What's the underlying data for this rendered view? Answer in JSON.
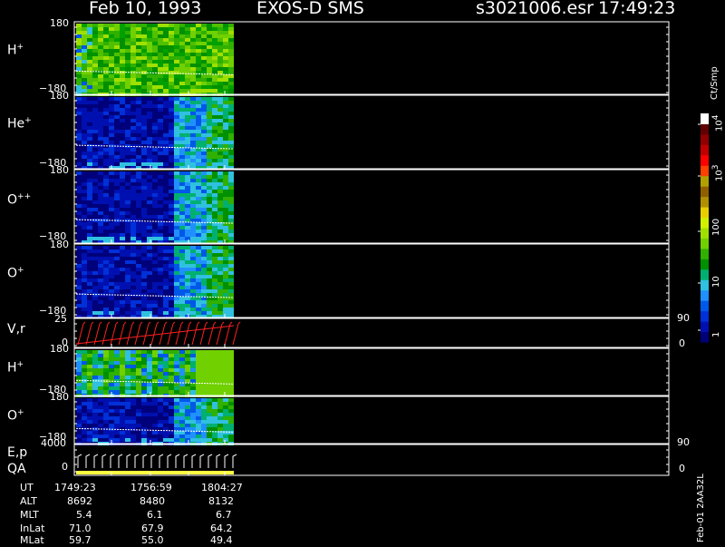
{
  "header": {
    "date": "Feb 10, 1993",
    "instrument": "EXOS-D SMS",
    "file": "s3021006.esr",
    "time": "17:49:23"
  },
  "colorbar": {
    "unit": "Ct/Smp",
    "ticks": [
      "1",
      "10",
      "100",
      "10",
      "10"
    ],
    "tick_exps": [
      "",
      "",
      "",
      "3",
      "4"
    ],
    "colors": [
      "#00007a",
      "#0010b0",
      "#0030d8",
      "#0058e8",
      "#2090ff",
      "#30c0e0",
      "#00b070",
      "#009000",
      "#30b000",
      "#70d000",
      "#a0e000",
      "#d0f000",
      "#e8d000",
      "#b09000",
      "#906000",
      "#b0a000",
      "#ff4000",
      "#ff0000",
      "#c00000",
      "#900000",
      "#600000",
      "#ffffff"
    ]
  },
  "panels": [
    {
      "species": "H",
      "charge": "+",
      "ymax": "180",
      "ymin": "−180"
    },
    {
      "species": "He",
      "charge": "+",
      "ymax": "180",
      "ymin": "−180"
    },
    {
      "species": "O",
      "charge": "++",
      "ymax": "180",
      "ymin": "−180"
    },
    {
      "species": "O",
      "charge": "+",
      "ymax": "180",
      "ymin": "−180"
    },
    {
      "species": "V,r",
      "charge": "",
      "ymax": "25",
      "ymin": "0",
      "right_top": "90",
      "right_bottom": "0"
    },
    {
      "species": "H",
      "charge": "+",
      "ymax": "180",
      "ymin": "−180"
    },
    {
      "species": "O",
      "charge": "+",
      "ymax": "180",
      "ymin": "−180"
    },
    {
      "species": "E,p",
      "species2": "QA",
      "charge": "",
      "ymax": "4000",
      "ymin": "0",
      "right_top": "90",
      "right_bottom": "0"
    }
  ],
  "footer": {
    "labels": [
      "UT",
      "ALT",
      "MLT",
      "InLat",
      "MLat"
    ],
    "columns": [
      [
        "1749:23",
        "8692",
        "5.4",
        "71.0",
        "59.7"
      ],
      [
        "1756:59",
        "8480",
        "6.1",
        "67.9",
        "55.0"
      ],
      [
        "1804:27",
        "8132",
        "6.7",
        "64.2",
        "49.4"
      ]
    ],
    "code": "Feb-01 2AA32L"
  },
  "chart_data": {
    "type": "heatmap",
    "title": "Feb 10, 1993   EXOS-D SMS",
    "xlabel": "UT",
    "x_ticks": [
      "1749:23",
      "1756:59",
      "1804:27"
    ],
    "colorbar_label": "Ct/Smp",
    "colorbar_scale": "log",
    "colorbar_range": [
      1,
      10000
    ],
    "series": [
      {
        "name": "H+",
        "ylim": [
          -180,
          180
        ]
      },
      {
        "name": "He+",
        "ylim": [
          -180,
          180
        ]
      },
      {
        "name": "O++",
        "ylim": [
          -180,
          180
        ]
      },
      {
        "name": "O+",
        "ylim": [
          -180,
          180
        ]
      },
      {
        "name": "V,r",
        "ylim": [
          0,
          25
        ],
        "right_ylim": [
          0,
          90
        ]
      },
      {
        "name": "H+",
        "ylim": [
          -180,
          180
        ]
      },
      {
        "name": "O+",
        "ylim": [
          -180,
          180
        ]
      },
      {
        "name": "E,p",
        "ylim": [
          0,
          4000
        ],
        "right_ylim": [
          0,
          90
        ]
      }
    ]
  }
}
